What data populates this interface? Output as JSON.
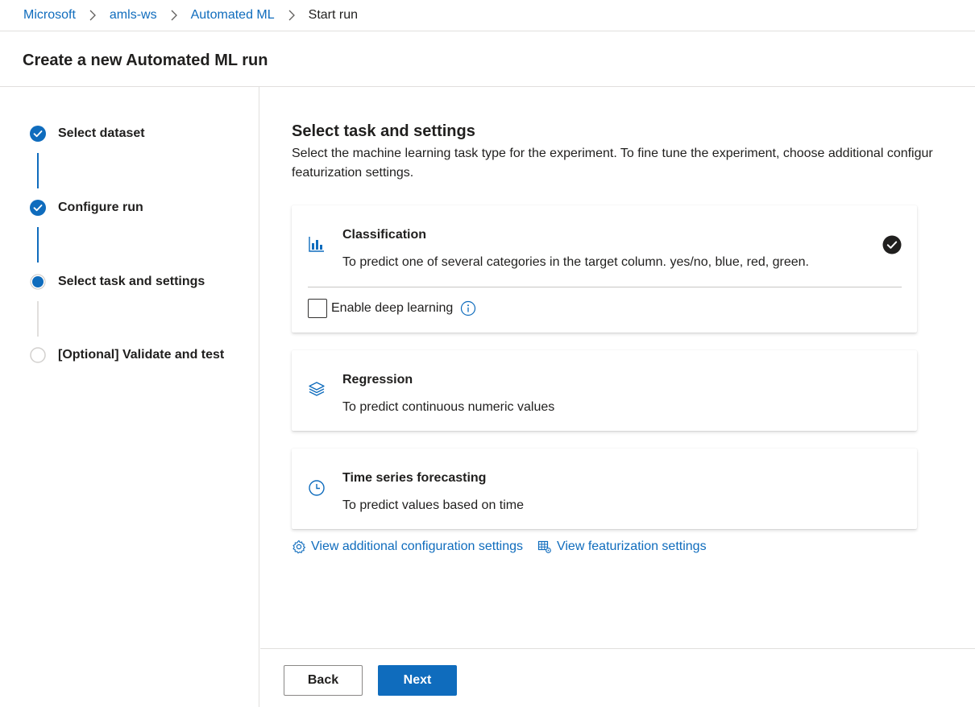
{
  "breadcrumb": {
    "items": [
      "Microsoft",
      "amls-ws",
      "Automated ML"
    ],
    "current": "Start run"
  },
  "page": {
    "title": "Create a new Automated ML run"
  },
  "steps": [
    {
      "label": "Select dataset",
      "state": "completed"
    },
    {
      "label": "Configure run",
      "state": "completed"
    },
    {
      "label": "Select task and settings",
      "state": "current"
    },
    {
      "label": "[Optional] Validate and test",
      "state": "pending"
    }
  ],
  "section": {
    "title": "Select task and settings",
    "description_line1": "Select the machine learning task type for the experiment. To fine tune the experiment, choose additional configur",
    "description_line2": "featurization settings."
  },
  "tasks": [
    {
      "title": "Classification",
      "description": "To predict one of several categories in the target column. yes/no, blue, red, green.",
      "icon": "bar-chart-icon",
      "selected": true
    },
    {
      "title": "Regression",
      "description": "To predict continuous numeric values",
      "icon": "stack-icon",
      "selected": false
    },
    {
      "title": "Time series forecasting",
      "description": "To predict values based on time",
      "icon": "clock-icon",
      "selected": false
    }
  ],
  "deep_learning": {
    "label": "Enable deep learning",
    "checked": false
  },
  "links": {
    "additional_config": "View additional configuration settings",
    "featurization": "View featurization settings"
  },
  "footer": {
    "back_label": "Back",
    "next_label": "Next"
  },
  "colors": {
    "accent": "#0f6cbd",
    "text": "#201f1e",
    "border": "#e1dfdd"
  }
}
